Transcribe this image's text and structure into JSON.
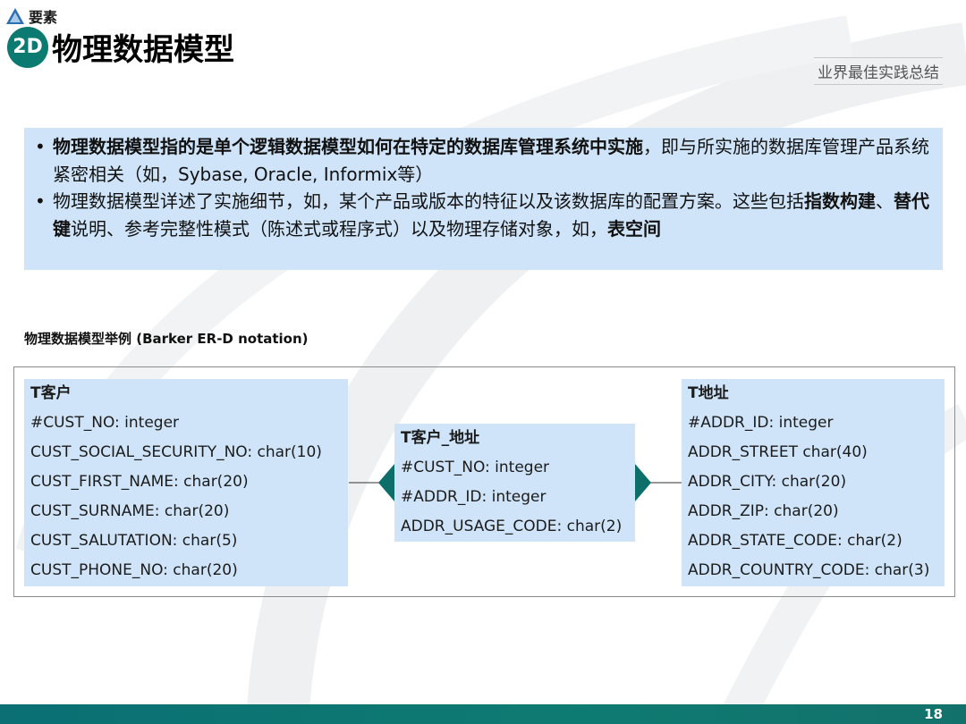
{
  "header": {
    "brand": "要素",
    "badge": "2D",
    "title": "物理数据模型",
    "tagline": "业界最佳实践总结"
  },
  "intro": {
    "bullet1": {
      "bold": "物理数据模型指的是单个逻辑数据模型如何在特定的数据库管理系统中实施",
      "rest": "，即与所实施的数据库管理产品系统紧密相关（如，Sybase, Oracle, Informix等）"
    },
    "bullet2": {
      "text1": "物理数据模型详述了实施细节，如，某个产品或版本的特征以及该数据库的配置方案。这些包括",
      "bold1": "指数构建",
      "sep": "、",
      "bold2": "替代键",
      "text2": "说明、参考完整性模式（陈述式或程序式）以及物理存储对象，如，",
      "bold3": "表空间"
    }
  },
  "diagram": {
    "label": "物理数据模型举例 (Barker ER-D notation)",
    "customer": {
      "name": "T客户",
      "attrs": [
        "#CUST_NO: integer",
        "CUST_SOCIAL_SECURITY_NO: char(10)",
        "CUST_FIRST_NAME: char(20)",
        "CUST_SURNAME: char(20)",
        "CUST_SALUTATION: char(5)",
        "CUST_PHONE_NO: char(20)"
      ]
    },
    "link": {
      "name": "T客户_地址",
      "attrs": [
        "#CUST_NO: integer",
        "#ADDR_ID: integer",
        "ADDR_USAGE_CODE: char(2)"
      ]
    },
    "address": {
      "name": "T地址",
      "attrs": [
        "#ADDR_ID: integer",
        "ADDR_STREET char(40)",
        "ADDR_CITY: char(20)",
        "ADDR_ZIP: char(20)",
        "ADDR_STATE_CODE: char(2)",
        "ADDR_COUNTRY_CODE: char(3)"
      ]
    }
  },
  "footer": {
    "page_number": "18"
  },
  "colors": {
    "teal": "#0b7a70",
    "entity_fill": "#cfe4f8"
  }
}
